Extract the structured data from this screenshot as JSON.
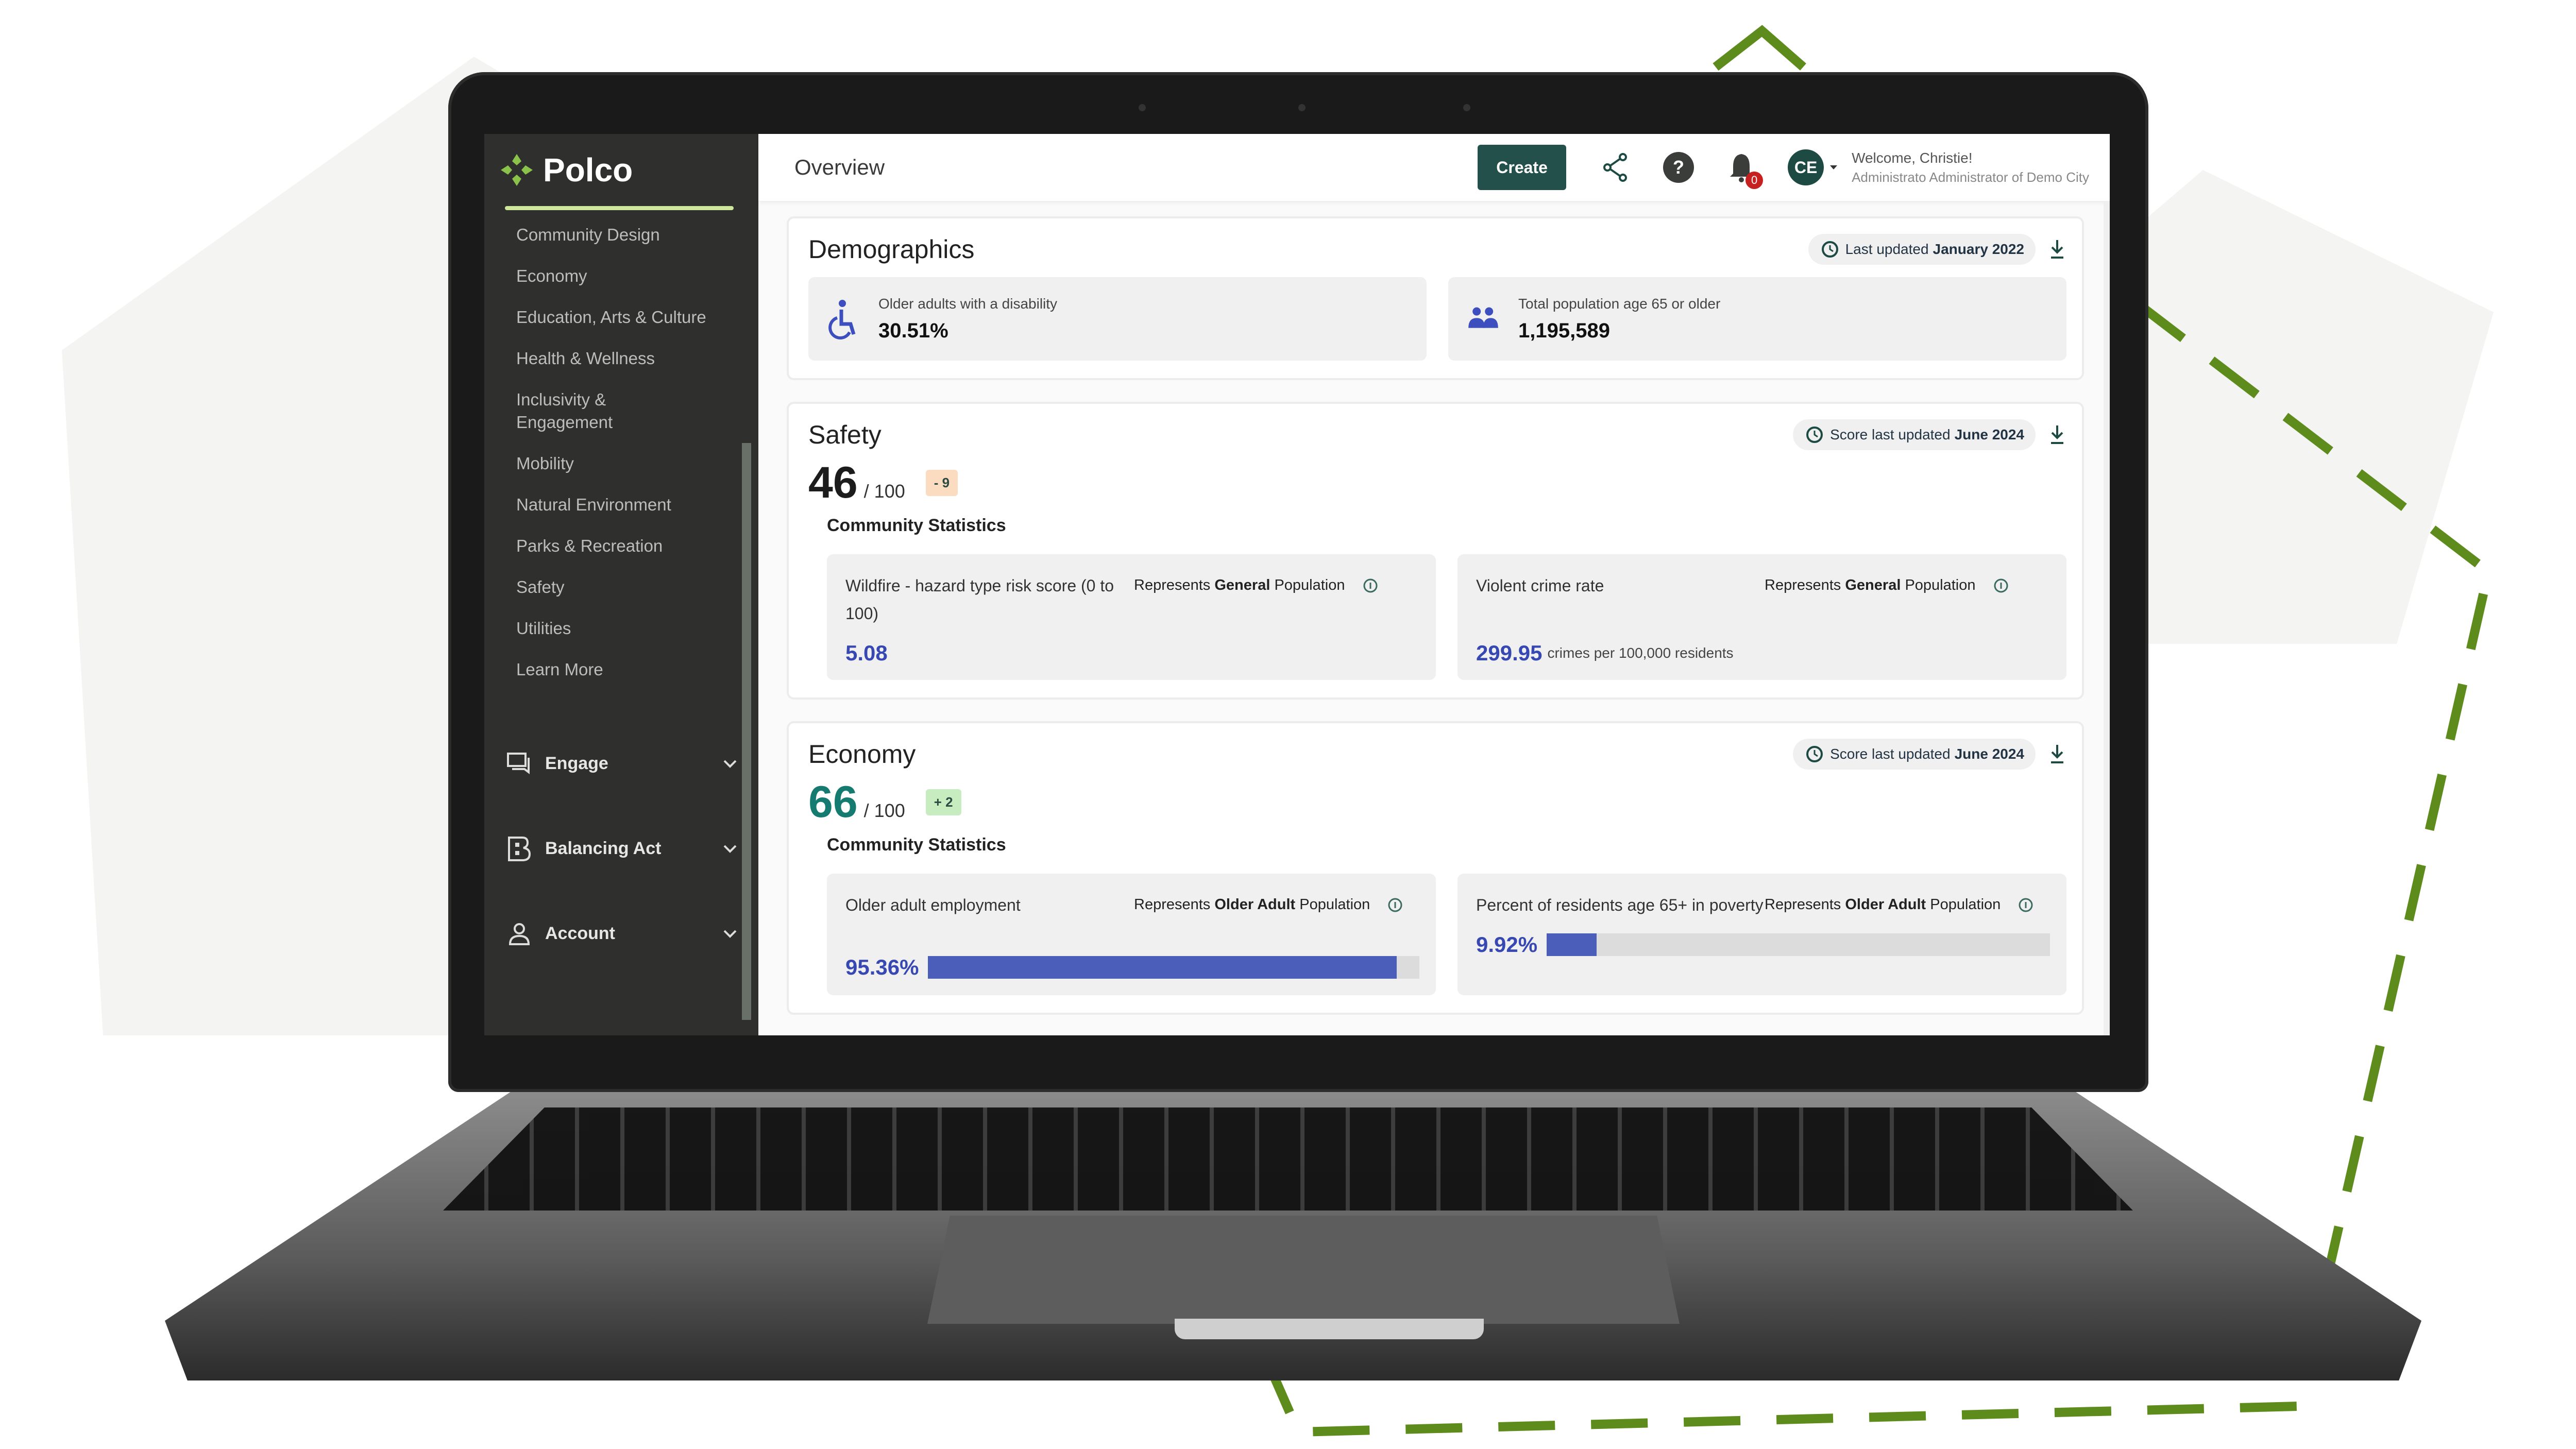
{
  "app": {
    "brand": "Polco",
    "page_title": "Overview"
  },
  "sidebar": {
    "items": [
      {
        "label": "Community Design"
      },
      {
        "label": "Economy"
      },
      {
        "label": "Education, Arts & Culture"
      },
      {
        "label": "Health & Wellness"
      },
      {
        "label": "Inclusivity & Engagement"
      },
      {
        "label": "Mobility"
      },
      {
        "label": "Natural Environment"
      },
      {
        "label": "Parks & Recreation"
      },
      {
        "label": "Safety"
      },
      {
        "label": "Utilities"
      },
      {
        "label": "Learn More"
      }
    ],
    "groups": [
      {
        "label": "Engage",
        "icon": "chat-icon"
      },
      {
        "label": "Balancing Act",
        "icon": "b-logo-icon"
      },
      {
        "label": "Account",
        "icon": "user-icon"
      }
    ]
  },
  "topbar": {
    "create_label": "Create",
    "notification_count": "0",
    "avatar_initials": "CE",
    "welcome": "Welcome, Christie!",
    "role": "Administrato  Administrator of Demo City"
  },
  "demographics": {
    "title": "Demographics",
    "updated_prefix": "Last updated",
    "updated_date": "January 2022",
    "cards": [
      {
        "icon": "wheelchair-icon",
        "label": "Older adults with a disability",
        "value": "30.51%"
      },
      {
        "icon": "people-icon",
        "label": "Total population age 65 or older",
        "value": "1,195,589"
      }
    ]
  },
  "safety": {
    "title": "Safety",
    "updated_prefix": "Score last updated",
    "updated_date": "June 2024",
    "score": "46",
    "score_max": "/ 100",
    "delta": "- 9",
    "stats_heading": "Community Statistics",
    "stats": [
      {
        "label": "Wildfire - hazard type risk score (0 to 100)",
        "represents_prefix": "Represents",
        "represents_group": "General",
        "represents_suffix": "Population",
        "value": "5.08",
        "unit": ""
      },
      {
        "label": "Violent crime rate",
        "represents_prefix": "Represents",
        "represents_group": "General",
        "represents_suffix": "Population",
        "value": "299.95",
        "unit": "crimes per 100,000 residents"
      }
    ]
  },
  "economy": {
    "title": "Economy",
    "updated_prefix": "Score last updated",
    "updated_date": "June 2024",
    "score": "66",
    "score_max": "/ 100",
    "delta": "+ 2",
    "stats_heading": "Community Statistics",
    "stats": [
      {
        "label": "Older adult employment",
        "represents_prefix": "Represents",
        "represents_group": "Older Adult",
        "represents_suffix": "Population",
        "value": "95.36%",
        "percent": 95.36
      },
      {
        "label": "Percent of residents age 65+ in poverty",
        "represents_prefix": "Represents",
        "represents_group": "Older Adult",
        "represents_suffix": "Population",
        "value": "9.92%",
        "percent": 9.92
      }
    ]
  },
  "colors": {
    "brand_green": "#8bc34a",
    "create_button": "#23504a",
    "value_blue": "#3748b3",
    "bar_blue": "#4b5fba",
    "score_teal": "#157a70",
    "delta_negative_bg": "#fbdcc1",
    "delta_positive_bg": "#c7ecc0"
  }
}
